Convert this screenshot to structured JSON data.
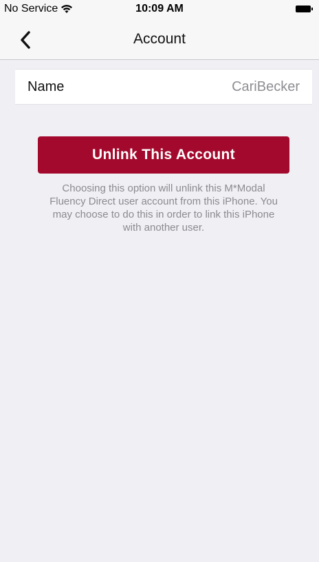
{
  "status_bar": {
    "carrier": "No Service",
    "time": "10:09 AM"
  },
  "nav": {
    "title": "Account"
  },
  "account": {
    "name_label": "Name",
    "name_value": "CariBecker"
  },
  "unlink": {
    "button_label": "Unlink This Account",
    "description": "Choosing this option will unlink this M*Modal Fluency Direct user account from this iPhone. You may choose to do this in order to link this iPhone with another user."
  },
  "colors": {
    "accent": "#a3092c",
    "background": "#efeff4"
  }
}
